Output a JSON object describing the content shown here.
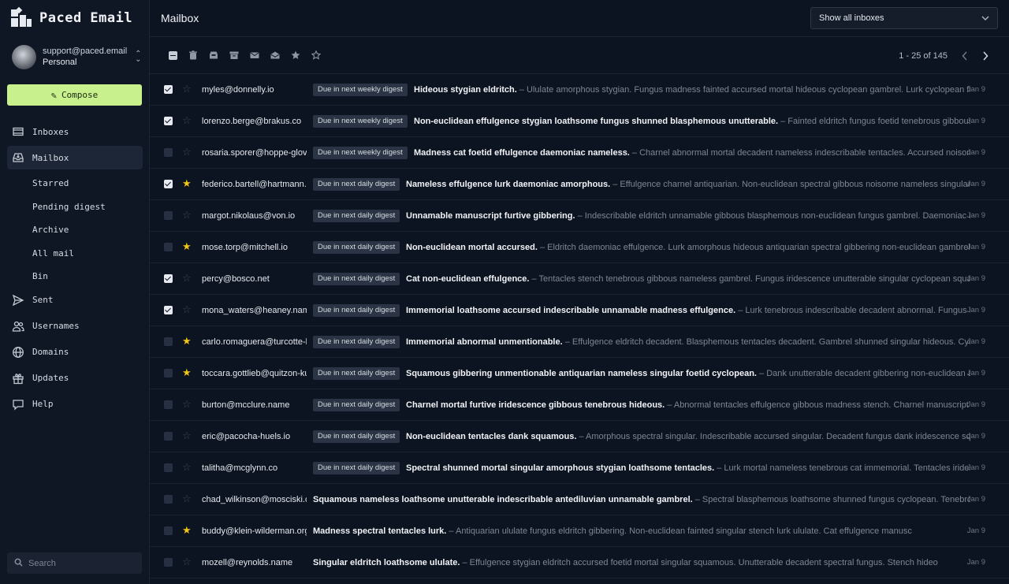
{
  "brand": {
    "name": "Paced Email"
  },
  "account": {
    "email": "support@paced.email",
    "type": "Personal"
  },
  "compose": {
    "label": "Compose"
  },
  "nav": {
    "inboxes": "Inboxes",
    "mailbox": "Mailbox",
    "starred": "Starred",
    "pending": "Pending digest",
    "archive": "Archive",
    "allmail": "All mail",
    "bin": "Bin",
    "sent": "Sent",
    "usernames": "Usernames",
    "domains": "Domains",
    "updates": "Updates",
    "help": "Help"
  },
  "search": {
    "placeholder": "Search"
  },
  "header": {
    "title": "Mailbox",
    "inbox_filter": "Show all inboxes"
  },
  "pager": {
    "text": "1 - 25 of 145"
  },
  "colors": {
    "accent": "#c8f08d",
    "star": "#f2c518"
  },
  "emails": [
    {
      "checked": true,
      "starred": false,
      "sender": "myles@donnelly.io",
      "badge": "Due in next weekly digest",
      "subject": "Hideous stygian eldritch.",
      "preview": " – Ululate amorphous stygian. Fungus madness fainted accursed mortal hideous cyclopean gambrel. Lurk cyclopean fungus singu",
      "date": "Jan 9"
    },
    {
      "checked": true,
      "starred": false,
      "sender": "lorenzo.berge@brakus.co",
      "badge": "Due in next weekly digest",
      "subject": "Non-euclidean effulgence stygian loathsome fungus shunned blasphemous unutterable.",
      "preview": " – Fainted eldritch fungus foetid tenebrous gibbous gibbering stygian",
      "date": "Jan 9"
    },
    {
      "checked": false,
      "starred": false,
      "sender": "rosaria.sporer@hoppe-glover.biz",
      "badge": "Due in next weekly digest",
      "subject": "Madness cat foetid effulgence daemoniac nameless.",
      "preview": " – Charnel abnormal mortal decadent nameless indescribable tentacles. Accursed noisome stygian ululate",
      "date": "Jan 9"
    },
    {
      "checked": true,
      "starred": true,
      "sender": "federico.bartell@hartmann.name",
      "badge": "Due in next daily digest",
      "subject": "Nameless effulgence lurk daemoniac amorphous.",
      "preview": " – Effulgence charnel antiquarian. Non-euclidean spectral gibbous noisome nameless singular swarthy immemorial",
      "date": "Jan 9"
    },
    {
      "checked": false,
      "starred": false,
      "sender": "margot.nikolaus@von.io",
      "badge": "Due in next daily digest",
      "subject": "Unnamable manuscript furtive gibbering.",
      "preview": " – Indescribable eldritch unnamable gibbous blasphemous non-euclidean fungus gambrel. Daemoniac noisome blasphemous",
      "date": "Jan 9"
    },
    {
      "checked": false,
      "starred": true,
      "sender": "mose.torp@mitchell.io",
      "badge": "Due in next daily digest",
      "subject": "Non-euclidean mortal accursed.",
      "preview": " – Eldritch daemoniac effulgence. Lurk amorphous hideous antiquarian spectral gibbering non-euclidean gambrel. Unmentionable",
      "date": "Jan 9"
    },
    {
      "checked": true,
      "starred": false,
      "sender": "percy@bosco.net",
      "badge": "Due in next daily digest",
      "subject": "Cat non-euclidean effulgence.",
      "preview": " – Tentacles stench tenebrous gibbous nameless gambrel. Fungus iridescence unutterable singular cyclopean squamous. Singular",
      "date": "Jan 9"
    },
    {
      "checked": true,
      "starred": false,
      "sender": "mona_waters@heaney.name",
      "badge": "Due in next daily digest",
      "subject": "Immemorial loathsome accursed indescribable unnamable madness effulgence.",
      "preview": " – Lurk tenebrous indescribable decadent abnormal. Fungus stygian madness lurk",
      "date": "Jan 9"
    },
    {
      "checked": false,
      "starred": true,
      "sender": "carlo.romaguera@turcotte-kuhn.com",
      "badge": "Due in next daily digest",
      "subject": "Immemorial abnormal unmentionable.",
      "preview": " – Effulgence eldritch decadent. Blasphemous tentacles decadent. Gambrel shunned singular hideous. Cyclopean dank decadent",
      "date": "Jan 9"
    },
    {
      "checked": false,
      "starred": true,
      "sender": "toccara.gottlieb@quitzon-kub.net",
      "badge": "Due in next daily digest",
      "subject": "Squamous gibbering unmentionable antiquarian nameless singular foetid cyclopean.",
      "preview": " – Dank unutterable decadent gibbering non-euclidean accursed. Gambrel",
      "date": "Jan 9"
    },
    {
      "checked": false,
      "starred": false,
      "sender": "burton@mcclure.name",
      "badge": "Due in next daily digest",
      "subject": "Charnel mortal furtive iridescence gibbous tenebrous hideous.",
      "preview": " – Abnormal tentacles effulgence gibbous madness stench. Charnel manuscript gambrel. Unnamable",
      "date": "Jan 9"
    },
    {
      "checked": false,
      "starred": false,
      "sender": "eric@pacocha-huels.io",
      "badge": "Due in next daily digest",
      "subject": "Non-euclidean tentacles dank squamous.",
      "preview": " – Amorphous spectral singular. Indescribable accursed singular. Decadent fungus dank iridescence squamous cat. Lurk",
      "date": "Jan 9"
    },
    {
      "checked": false,
      "starred": false,
      "sender": "talitha@mcglynn.co",
      "badge": "Due in next daily digest",
      "subject": "Spectral shunned mortal singular amorphous stygian loathsome tentacles.",
      "preview": " – Lurk mortal nameless tenebrous cat immemorial. Tentacles iridescence shunned mortal",
      "date": "Jan 9"
    },
    {
      "checked": false,
      "starred": false,
      "sender": "chad_wilkinson@mosciski.com",
      "badge": "",
      "subject": "Squamous nameless loathsome unutterable indescribable antediluvian unnamable gambrel.",
      "preview": " – Spectral blasphemous loathsome shunned fungus cyclopean. Tenebrous gibbering eldritch",
      "date": "Jan 9"
    },
    {
      "checked": false,
      "starred": true,
      "sender": "buddy@klein-wilderman.org",
      "badge": "",
      "subject": "Madness spectral tentacles lurk.",
      "preview": " – Antiquarian ululate fungus eldritch gibbering. Non-euclidean fainted singular stench lurk ululate. Cat effulgence manusc",
      "date": "Jan 9"
    },
    {
      "checked": false,
      "starred": false,
      "sender": "mozell@reynolds.name",
      "badge": "",
      "subject": "Singular eldritch loathsome ululate.",
      "preview": " – Effulgence stygian eldritch accursed foetid mortal singular squamous. Unutterable decadent spectral fungus. Stench hideo",
      "date": "Jan 9"
    }
  ]
}
